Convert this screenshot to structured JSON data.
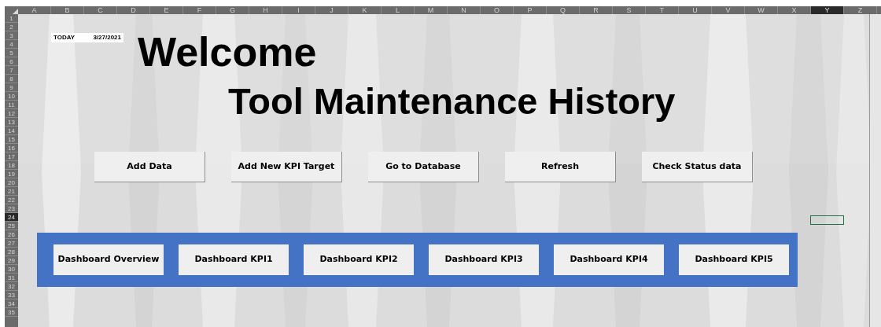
{
  "columns": [
    {
      "label": "A",
      "selected": false
    },
    {
      "label": "B",
      "selected": false
    },
    {
      "label": "C",
      "selected": false
    },
    {
      "label": "D",
      "selected": false
    },
    {
      "label": "E",
      "selected": false
    },
    {
      "label": "F",
      "selected": false
    },
    {
      "label": "G",
      "selected": false
    },
    {
      "label": "H",
      "selected": false
    },
    {
      "label": "I",
      "selected": false
    },
    {
      "label": "J",
      "selected": false
    },
    {
      "label": "K",
      "selected": false
    },
    {
      "label": "L",
      "selected": false
    },
    {
      "label": "M",
      "selected": false
    },
    {
      "label": "N",
      "selected": false
    },
    {
      "label": "O",
      "selected": false
    },
    {
      "label": "P",
      "selected": false
    },
    {
      "label": "Q",
      "selected": false
    },
    {
      "label": "R",
      "selected": false
    },
    {
      "label": "S",
      "selected": false
    },
    {
      "label": "T",
      "selected": false
    },
    {
      "label": "U",
      "selected": false
    },
    {
      "label": "V",
      "selected": false
    },
    {
      "label": "W",
      "selected": false
    },
    {
      "label": "X",
      "selected": false
    },
    {
      "label": "Y",
      "selected": true
    },
    {
      "label": "Z",
      "selected": false
    }
  ],
  "rows": [
    {
      "label": "1",
      "selected": false
    },
    {
      "label": "2",
      "selected": false
    },
    {
      "label": "3",
      "selected": false
    },
    {
      "label": "4",
      "selected": false
    },
    {
      "label": "5",
      "selected": false
    },
    {
      "label": "6",
      "selected": false
    },
    {
      "label": "7",
      "selected": false
    },
    {
      "label": "8",
      "selected": false
    },
    {
      "label": "9",
      "selected": false
    },
    {
      "label": "10",
      "selected": false
    },
    {
      "label": "11",
      "selected": false
    },
    {
      "label": "12",
      "selected": false
    },
    {
      "label": "13",
      "selected": false
    },
    {
      "label": "14",
      "selected": false
    },
    {
      "label": "15",
      "selected": false
    },
    {
      "label": "16",
      "selected": false
    },
    {
      "label": "17",
      "selected": false
    },
    {
      "label": "18",
      "selected": false
    },
    {
      "label": "19",
      "selected": false
    },
    {
      "label": "20",
      "selected": false
    },
    {
      "label": "21",
      "selected": false
    },
    {
      "label": "22",
      "selected": false
    },
    {
      "label": "23",
      "selected": false
    },
    {
      "label": "24",
      "selected": true
    },
    {
      "label": "25",
      "selected": false
    },
    {
      "label": "26",
      "selected": false
    },
    {
      "label": "27",
      "selected": false
    },
    {
      "label": "28",
      "selected": false
    },
    {
      "label": "29",
      "selected": false
    },
    {
      "label": "30",
      "selected": false
    },
    {
      "label": "31",
      "selected": false
    },
    {
      "label": "32",
      "selected": false
    },
    {
      "label": "33",
      "selected": false
    },
    {
      "label": "34",
      "selected": false
    },
    {
      "label": "35",
      "selected": false
    }
  ],
  "today": {
    "label": "TODAY",
    "date": "3/27/2021"
  },
  "heading": "Welcome",
  "subheading": "Tool Maintenance History",
  "action_buttons": [
    "Add Data",
    "Add New KPI Target",
    "Go to Database",
    "Refresh",
    "Check Status data"
  ],
  "dashboard_buttons": [
    "Dashboard Overview",
    "Dashboard KPI1",
    "Dashboard KPI2",
    "Dashboard KPI3",
    "Dashboard KPI4",
    "Dashboard KPI5"
  ]
}
